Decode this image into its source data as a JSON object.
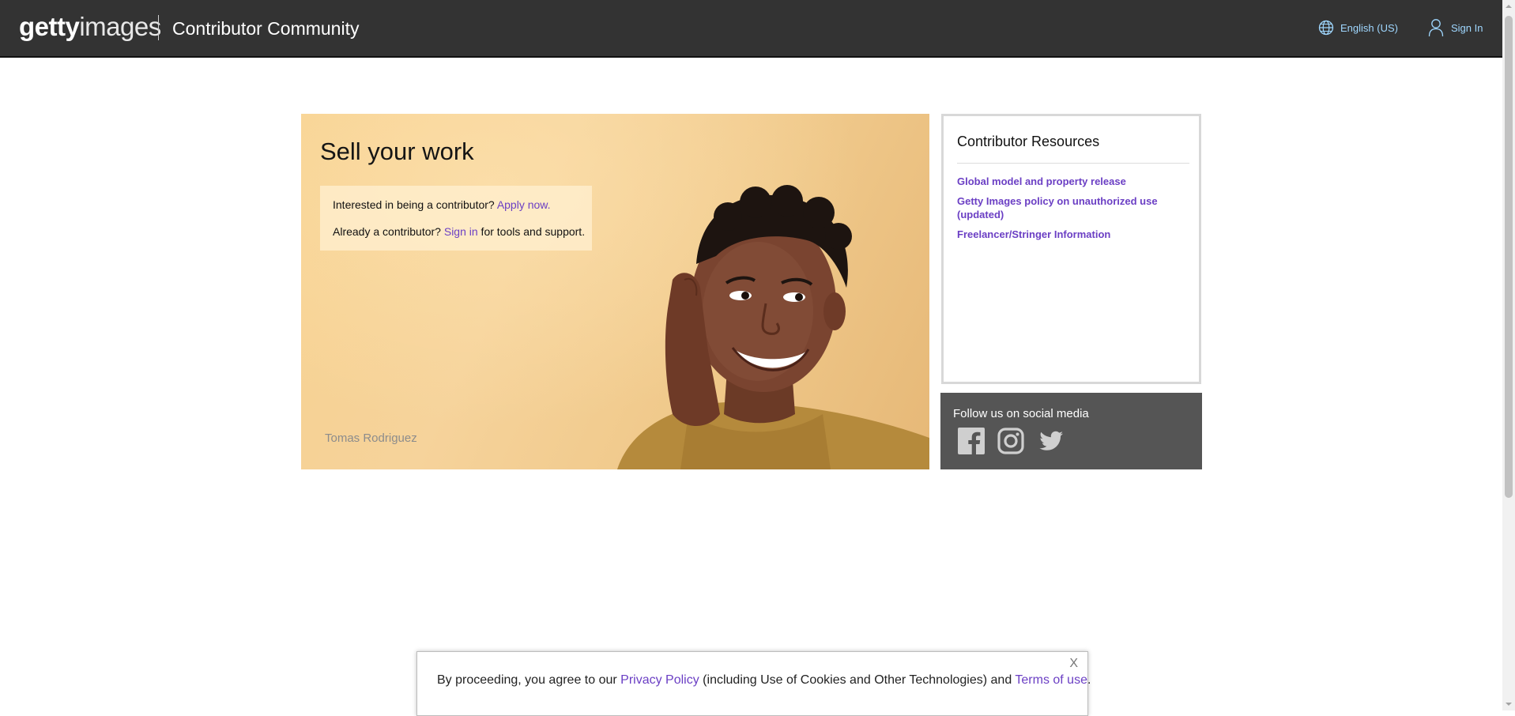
{
  "header": {
    "logo_bold": "getty",
    "logo_light": "images",
    "community_title": "Contributor Community",
    "language_label": "English (US)",
    "signin_label": "Sign In",
    "link_color": "#9fd7ff"
  },
  "hero": {
    "title": "Sell your work",
    "line1_text": "Interested in being a contributor? ",
    "line1_link": "Apply now.",
    "line2_text_before": "Already a contributor? ",
    "line2_link": "Sign in",
    "line2_text_after": " for tools and support.",
    "photo_credit": "Tomas Rodriguez"
  },
  "resources": {
    "title": "Contributor Resources",
    "links": [
      "Global model and property release",
      "Getty Images policy on unauthorized use (updated)",
      "Freelancer/Stringer Information"
    ],
    "link_color": "#6b3fc4"
  },
  "social": {
    "title": "Follow us on social media",
    "icons": [
      "facebook-icon",
      "instagram-icon",
      "twitter-icon"
    ]
  },
  "cookie_banner": {
    "text_before": "By proceeding, you agree to our ",
    "privacy_link": "Privacy Policy",
    "text_middle": " (including Use of Cookies and Other Technologies) and ",
    "terms_link": "Terms of use",
    "text_after": ".",
    "close_label": "X"
  }
}
